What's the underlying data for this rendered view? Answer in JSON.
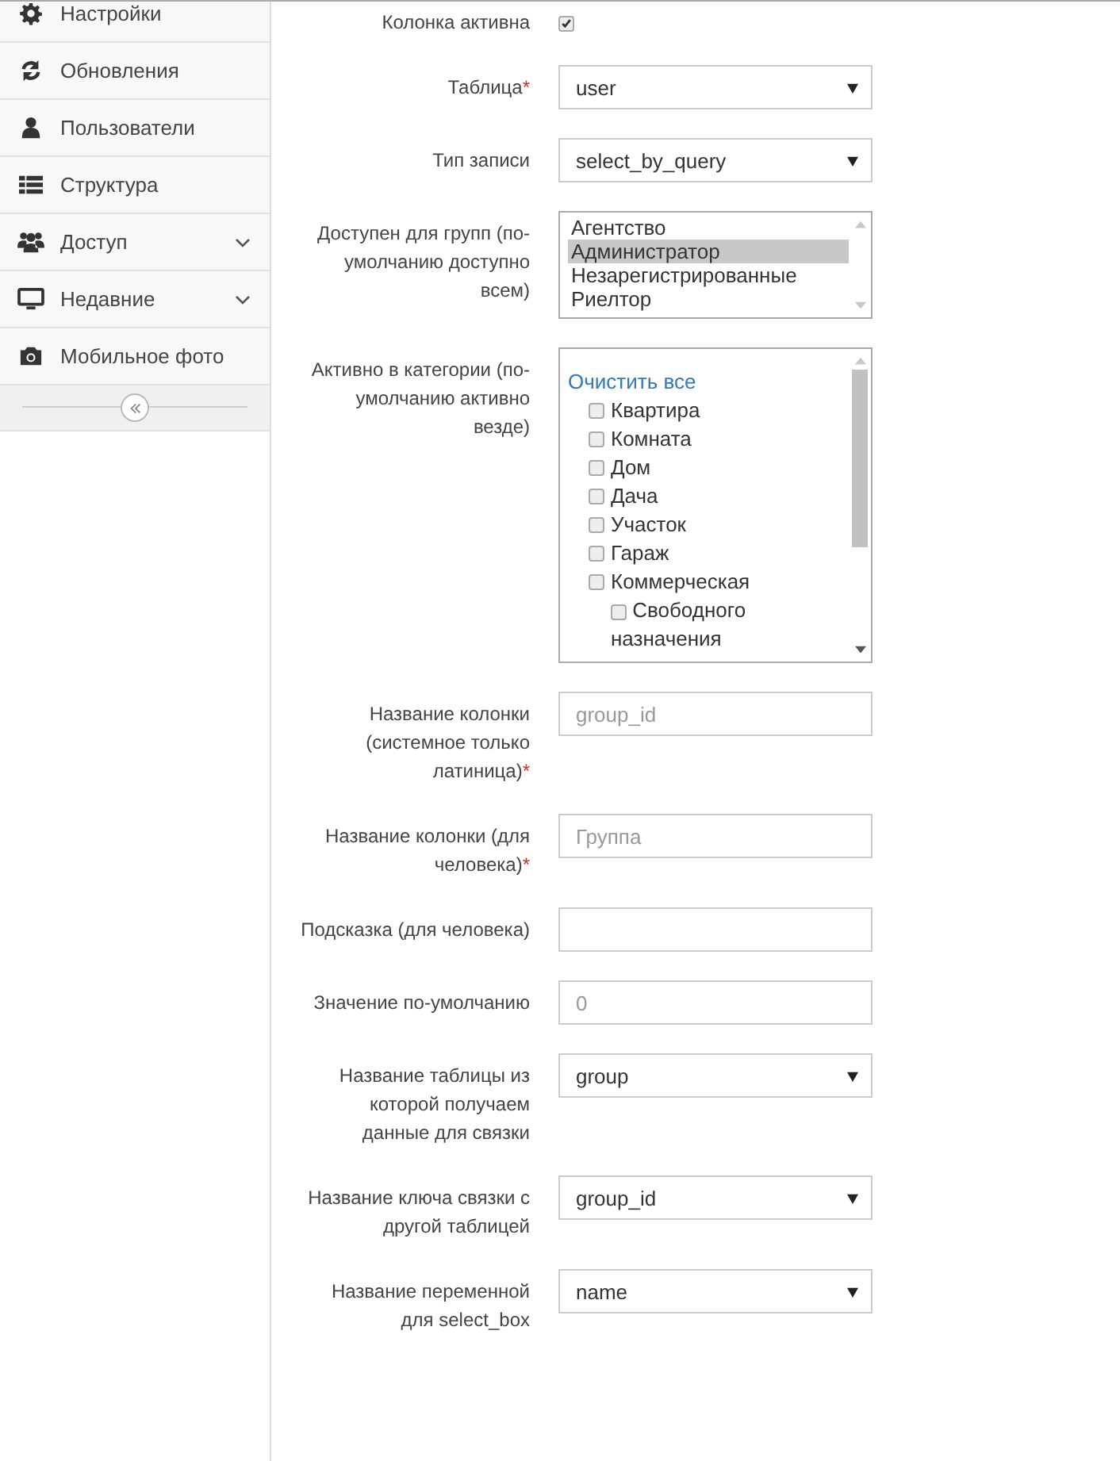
{
  "sidebar": {
    "items": [
      {
        "label": "Настройки",
        "submenu": false
      },
      {
        "label": "Обновления",
        "submenu": false
      },
      {
        "label": "Пользователи",
        "submenu": false
      },
      {
        "label": "Структура",
        "submenu": false
      },
      {
        "label": "Доступ",
        "submenu": true
      },
      {
        "label": "Недавние",
        "submenu": true
      },
      {
        "label": "Мобильное фото",
        "submenu": false
      }
    ]
  },
  "form": {
    "fields": [
      {
        "kind": "checkbox",
        "label": "Колонка активна",
        "checked": true
      },
      {
        "kind": "select",
        "label": "Таблица",
        "required_mark": "*",
        "value": "user"
      },
      {
        "kind": "select",
        "label": "Тип записи",
        "value": "select_by_query"
      },
      {
        "kind": "listbox",
        "label": "Доступен для групп (по-умолчанию доступно всем)",
        "options": [
          {
            "label": "Агентство",
            "selected": false
          },
          {
            "label": "Администратор",
            "selected": true
          },
          {
            "label": "Незарегистрированные",
            "selected": false
          },
          {
            "label": "Риелтор",
            "selected": false
          }
        ]
      },
      {
        "kind": "tree",
        "label": "Активно в категории (по-умолчанию активно везде)",
        "clear_link": "Очистить все",
        "items": [
          {
            "label": "Квартира",
            "checked": false
          },
          {
            "label": "Комната",
            "checked": false
          },
          {
            "label": "Дом",
            "checked": false
          },
          {
            "label": "Дача",
            "checked": false
          },
          {
            "label": "Участок",
            "checked": false
          },
          {
            "label": "Гараж",
            "checked": false
          },
          {
            "label": "Коммерческая",
            "checked": false,
            "children": [
              {
                "label": "Свободного назначения",
                "checked": false
              }
            ]
          }
        ]
      },
      {
        "kind": "text",
        "label": "Название колонки (системное только латиница)",
        "required_mark": "*",
        "placeholder": "group_id"
      },
      {
        "kind": "text",
        "label": "Название колонки (для человека)",
        "required_mark": "*",
        "placeholder": "Группа"
      },
      {
        "kind": "text",
        "label": "Подсказка (для человека)"
      },
      {
        "kind": "text",
        "label": "Значение по-умолчанию",
        "placeholder": "0"
      },
      {
        "kind": "select",
        "label": "Название таблицы из которой получаем данные для связки",
        "value": "group"
      },
      {
        "kind": "select",
        "label": "Название ключа связки с другой таблицей",
        "value": "group_id"
      },
      {
        "kind": "select",
        "label": "Название переменной для select_box",
        "value": "name"
      }
    ]
  }
}
